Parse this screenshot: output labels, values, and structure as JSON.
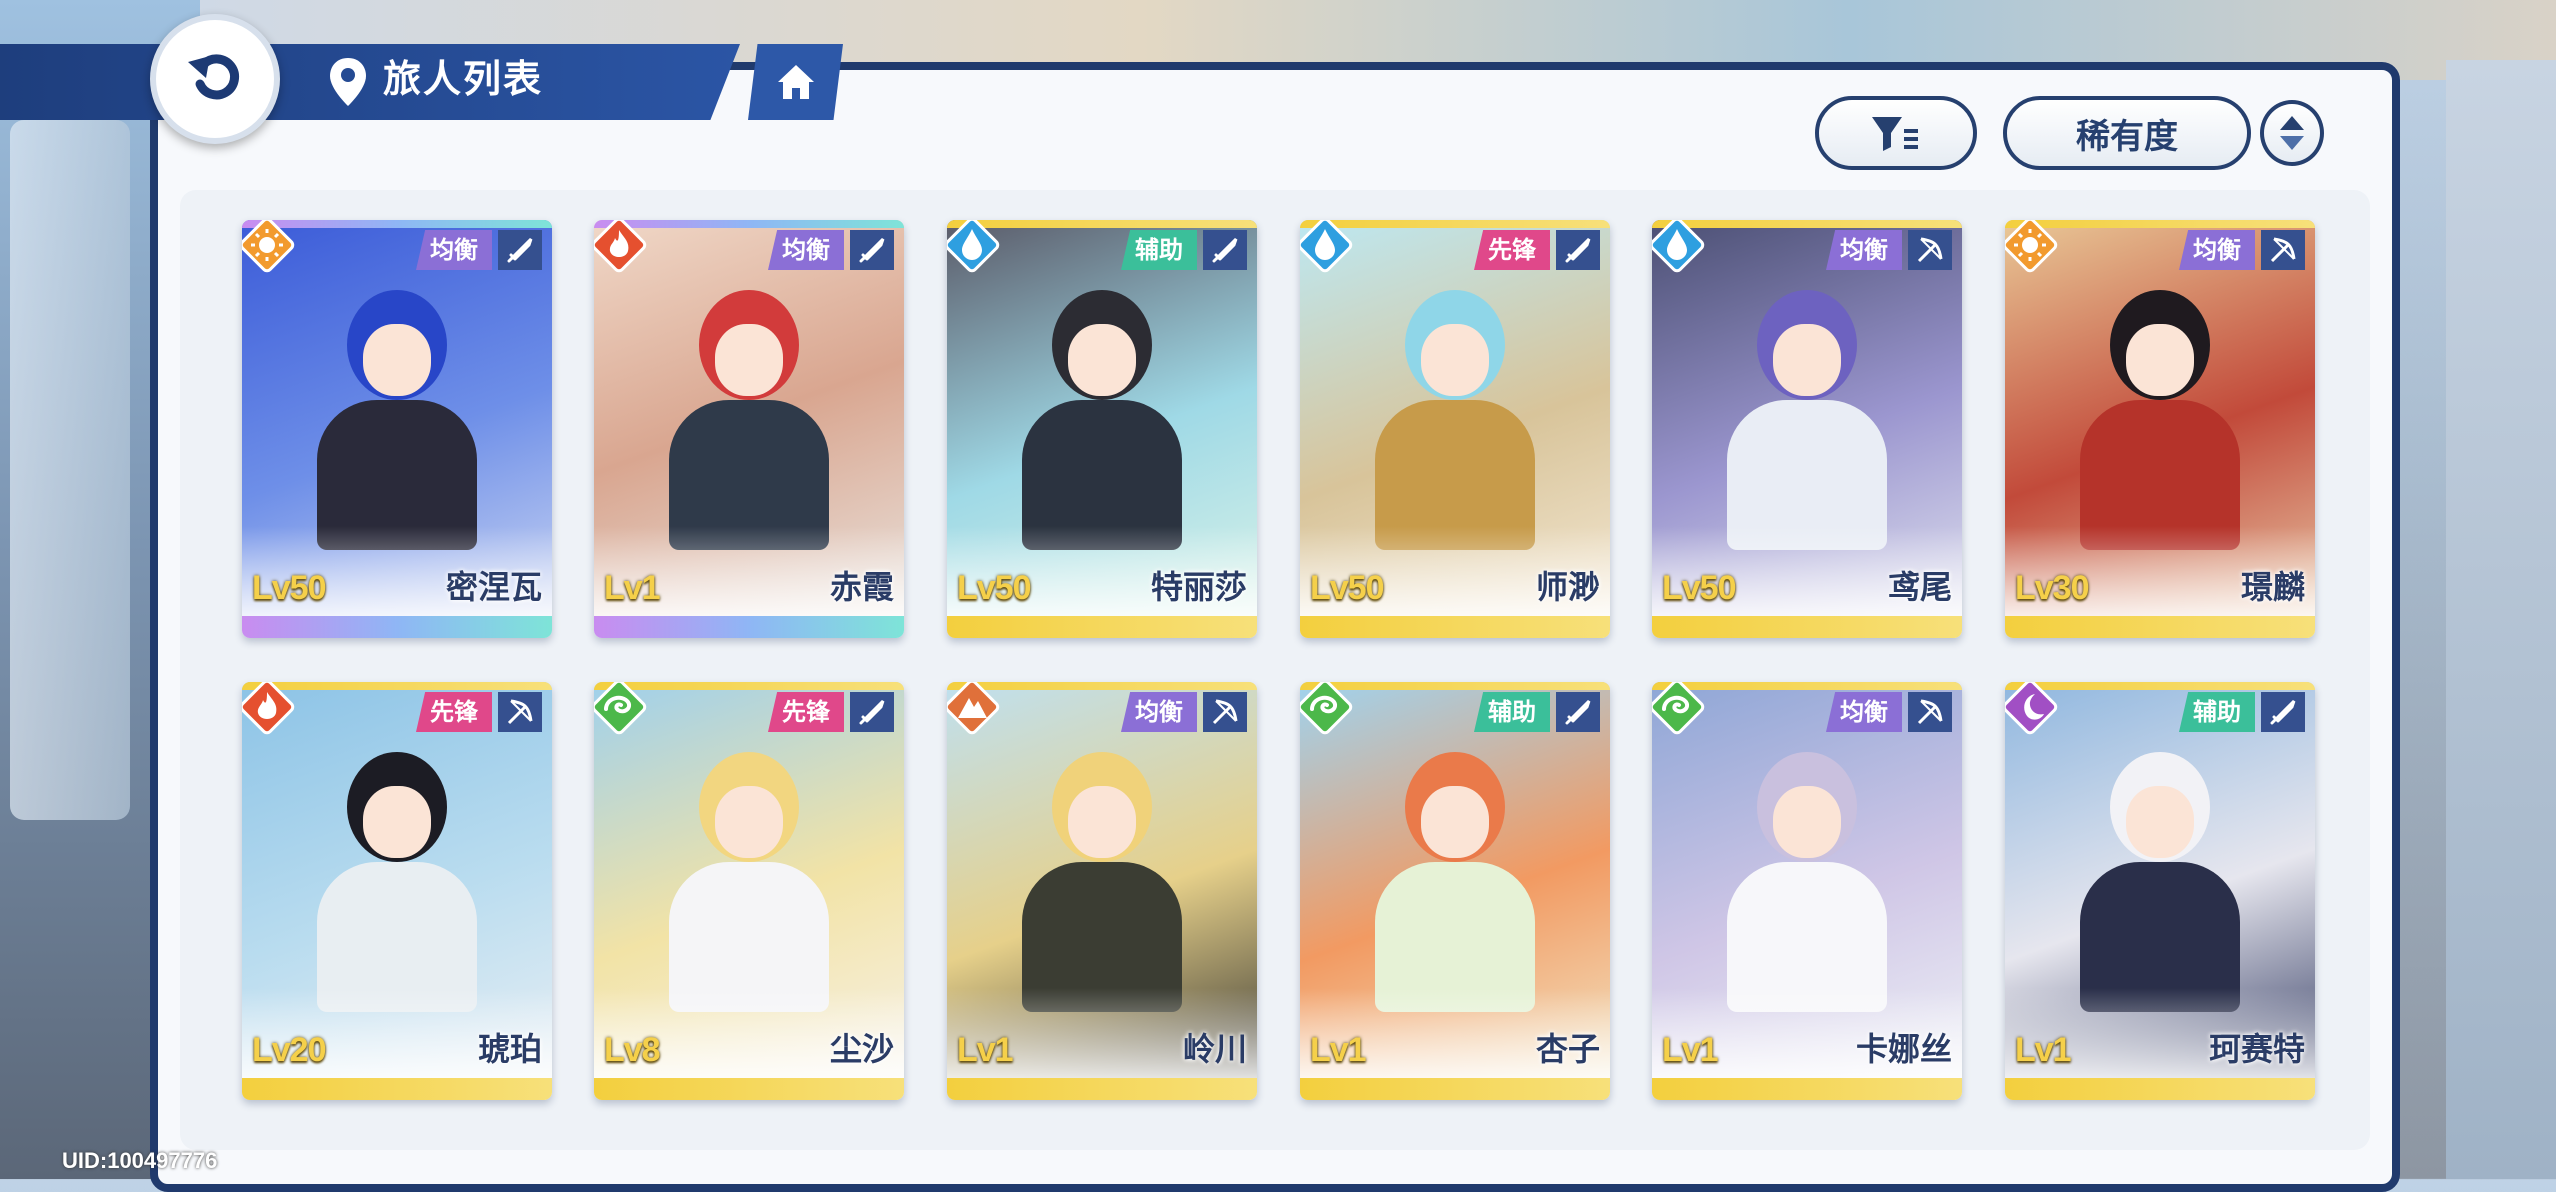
{
  "header": {
    "title": "旅人列表"
  },
  "controls": {
    "sort_label": "稀有度"
  },
  "uid": "UID:100497776",
  "colors": {
    "navy": "#203a6d",
    "role_balance": "#8b6fd6",
    "role_support": "#3bbf9a",
    "role_vanguard": "#e0488a",
    "rarity_rainbow": "linear-gradient",
    "rarity_gold": "#f2c230"
  },
  "travelers": [
    {
      "level": "Lv50",
      "name": "密涅瓦",
      "role": "均衡",
      "weapon": "sword-icon",
      "element": "sun-icon"
    },
    {
      "level": "Lv1",
      "name": "赤霞",
      "role": "均衡",
      "weapon": "sword-icon",
      "element": "fire-icon"
    },
    {
      "level": "Lv50",
      "name": "特丽莎",
      "role": "辅助",
      "weapon": "sword-icon",
      "element": "water-icon"
    },
    {
      "level": "Lv50",
      "name": "师渺",
      "role": "先锋",
      "weapon": "sword-icon",
      "element": "water-icon"
    },
    {
      "level": "Lv50",
      "name": "鸢尾",
      "role": "均衡",
      "weapon": "bow-icon",
      "element": "water-icon"
    },
    {
      "level": "Lv30",
      "name": "璟麟",
      "role": "均衡",
      "weapon": "bow-icon",
      "element": "sun-icon"
    },
    {
      "level": "Lv20",
      "name": "琥珀",
      "role": "先锋",
      "weapon": "bow-icon",
      "element": "fire-icon"
    },
    {
      "level": "Lv8",
      "name": "尘沙",
      "role": "先锋",
      "weapon": "sword-icon",
      "element": "wind-icon"
    },
    {
      "level": "Lv1",
      "name": "岭川",
      "role": "均衡",
      "weapon": "bow-icon",
      "element": "earth-icon"
    },
    {
      "level": "Lv1",
      "name": "杏子",
      "role": "辅助",
      "weapon": "sword-icon",
      "element": "wind-icon"
    },
    {
      "level": "Lv1",
      "name": "卡娜丝",
      "role": "均衡",
      "weapon": "bow-icon",
      "element": "wind-icon"
    },
    {
      "level": "Lv1",
      "name": "珂赛特",
      "role": "辅助",
      "weapon": "sword-icon",
      "element": "moon-icon"
    }
  ]
}
